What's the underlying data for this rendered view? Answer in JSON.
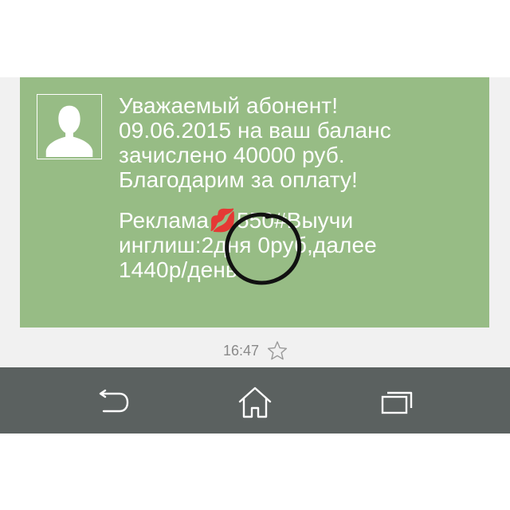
{
  "message": {
    "paragraph1": "Уважаемый абонент!\n09.06.2015 на ваш баланс\nзачислено 40000 руб.\nБлагодарим за оплату!",
    "paragraph2": "Реклама💋550#Выучи\nинглиш:2дня 0руб,далее\n1440р/день",
    "time": "16:47"
  },
  "icons": {
    "avatar": "person-silhouette-icon",
    "favorite": "star-outline-icon",
    "annotation": "hand-drawn-circle",
    "back": "back-arrow-icon",
    "home": "home-icon",
    "recents": "recent-apps-icon"
  },
  "colors": {
    "bubble": "#97bc85",
    "navbar": "#5b6160",
    "message_text": "#ffffff",
    "time_text": "#8a8a8a"
  }
}
